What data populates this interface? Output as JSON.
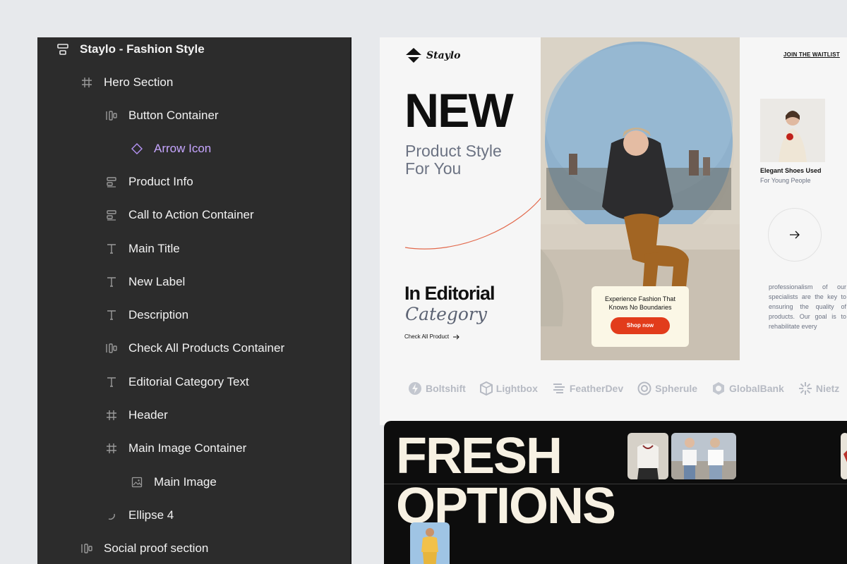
{
  "layers_panel": {
    "items": [
      {
        "label": "Staylo - Fashion Style",
        "icon": "stack-icon"
      },
      {
        "label": "Hero Section",
        "icon": "frame-icon"
      },
      {
        "label": "Button Container",
        "icon": "auto-layout-horizontal-icon"
      },
      {
        "label": "Arrow Icon",
        "icon": "component-diamond-icon"
      },
      {
        "label": "Product Info",
        "icon": "auto-layout-vertical-icon"
      },
      {
        "label": "Call to Action Container",
        "icon": "auto-layout-vertical-icon"
      },
      {
        "label": "Main Title",
        "icon": "text-icon"
      },
      {
        "label": "New Label",
        "icon": "text-icon"
      },
      {
        "label": "Description",
        "icon": "text-icon"
      },
      {
        "label": "Check All Products Container",
        "icon": "auto-layout-horizontal-icon"
      },
      {
        "label": "Editorial Category Text",
        "icon": "text-icon"
      },
      {
        "label": "Header",
        "icon": "frame-icon"
      },
      {
        "label": "Main Image Container",
        "icon": "frame-icon"
      },
      {
        "label": "Main Image",
        "icon": "image-icon"
      },
      {
        "label": "Ellipse 4",
        "icon": "ellipse-arc-icon"
      },
      {
        "label": "Social proof section",
        "icon": "auto-layout-horizontal-icon"
      }
    ]
  },
  "site": {
    "logo_text": "Staylo",
    "waitlist_link": "JOIN THE WAITLIST",
    "hero_title": "NEW",
    "hero_sub_line1": "Product Style",
    "hero_sub_line2": "For You",
    "editorial_line1": "In Editorial",
    "editorial_line2": "Category",
    "check_link": "Check All Product",
    "cta_text": "Experience Fashion That Knows No Boundaries",
    "cta_button": "Shop now",
    "side_caption_title": "Elegant Shoes Used",
    "side_caption_sub": "For Young People",
    "body_text": "professionalism of our specialists are the key to ensuring the quality of products. Our goal is to rehabilitate every",
    "brands": [
      "Boltshift",
      "Lightbox",
      "FeatherDev",
      "Spherule",
      "GlobalBank",
      "Nietz"
    ]
  },
  "dark_section": {
    "title_line1": "FRESH",
    "title_line2": "OPTIONS"
  },
  "colors": {
    "panel_bg": "#2c2c2c",
    "accent_orange": "#e23c1b",
    "highlight_purple": "#c6a6ff",
    "cream": "#f7f1e3"
  }
}
